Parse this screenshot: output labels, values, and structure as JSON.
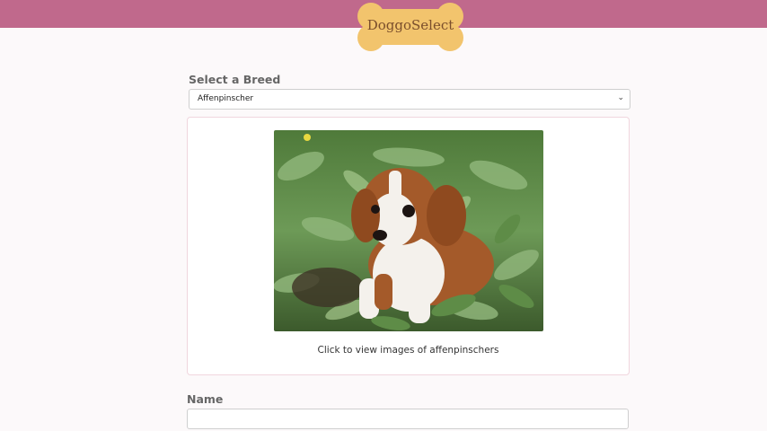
{
  "header": {
    "logo_text": "DoggoSelect",
    "bar_color": "#c0698c",
    "logo_color": "#f2c46d"
  },
  "form": {
    "breed_label": "Select a Breed",
    "breed_selected": "Affenpinscher",
    "name_label": "Name",
    "name_value": ""
  },
  "breed_card": {
    "image": "puppy-photo",
    "caption": "Click to view images of affenpinschers"
  }
}
